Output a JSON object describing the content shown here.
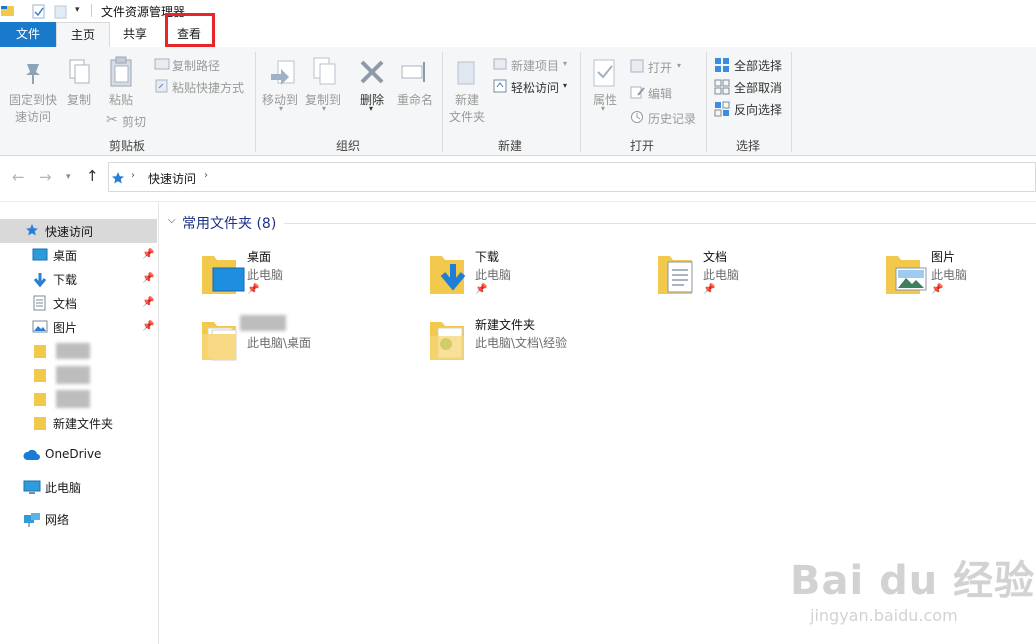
{
  "window": {
    "title": "文件资源管理器"
  },
  "tabs": {
    "file": "文件",
    "home": "主页",
    "share": "共享",
    "view": "查看"
  },
  "ribbon": {
    "clipboard": {
      "label": "剪贴板",
      "pin": "固定到快\n速访问",
      "pin1": "固定到快",
      "pin2": "速访问",
      "copy": "复制",
      "paste": "粘贴",
      "copy_path": "复制路径",
      "paste_shortcut": "粘贴快捷方式",
      "cut": "剪切"
    },
    "organize": {
      "label": "组织",
      "move_to": "移动到",
      "copy_to": "复制到",
      "delete": "删除",
      "rename": "重命名"
    },
    "new": {
      "label": "新建",
      "new_folder1": "新建",
      "new_folder2": "文件夹",
      "new_item": "新建项目",
      "easy_access": "轻松访问"
    },
    "open": {
      "label": "打开",
      "properties": "属性",
      "open": "打开",
      "edit": "编辑",
      "history": "历史记录"
    },
    "select": {
      "label": "选择",
      "select_all": "全部选择",
      "select_none": "全部取消",
      "invert": "反向选择"
    }
  },
  "address": {
    "crumb": "快速访问"
  },
  "nav": {
    "quick_access": "快速访问",
    "desktop": "桌面",
    "downloads": "下载",
    "documents": "文档",
    "pictures": "图片",
    "new_folder": "新建文件夹",
    "onedrive": "OneDrive",
    "this_pc": "此电脑",
    "network": "网络"
  },
  "section": {
    "title": "常用文件夹 (8)"
  },
  "tiles": [
    {
      "name": "桌面",
      "sub": "此电脑"
    },
    {
      "name": "下载",
      "sub": "此电脑"
    },
    {
      "name": "文档",
      "sub": "此电脑"
    },
    {
      "name": "图片",
      "sub": "此电脑"
    },
    {
      "name": "",
      "sub": "此电脑\\桌面"
    },
    {
      "name": "新建文件夹",
      "sub": "此电脑\\文档\\经验"
    }
  ],
  "watermark": {
    "brand": "Bai du 经验",
    "url": "jingyan.baidu.com"
  },
  "colors": {
    "accent": "#1979ca",
    "highlight": "#e8262a",
    "folder": "#f2c94c"
  }
}
